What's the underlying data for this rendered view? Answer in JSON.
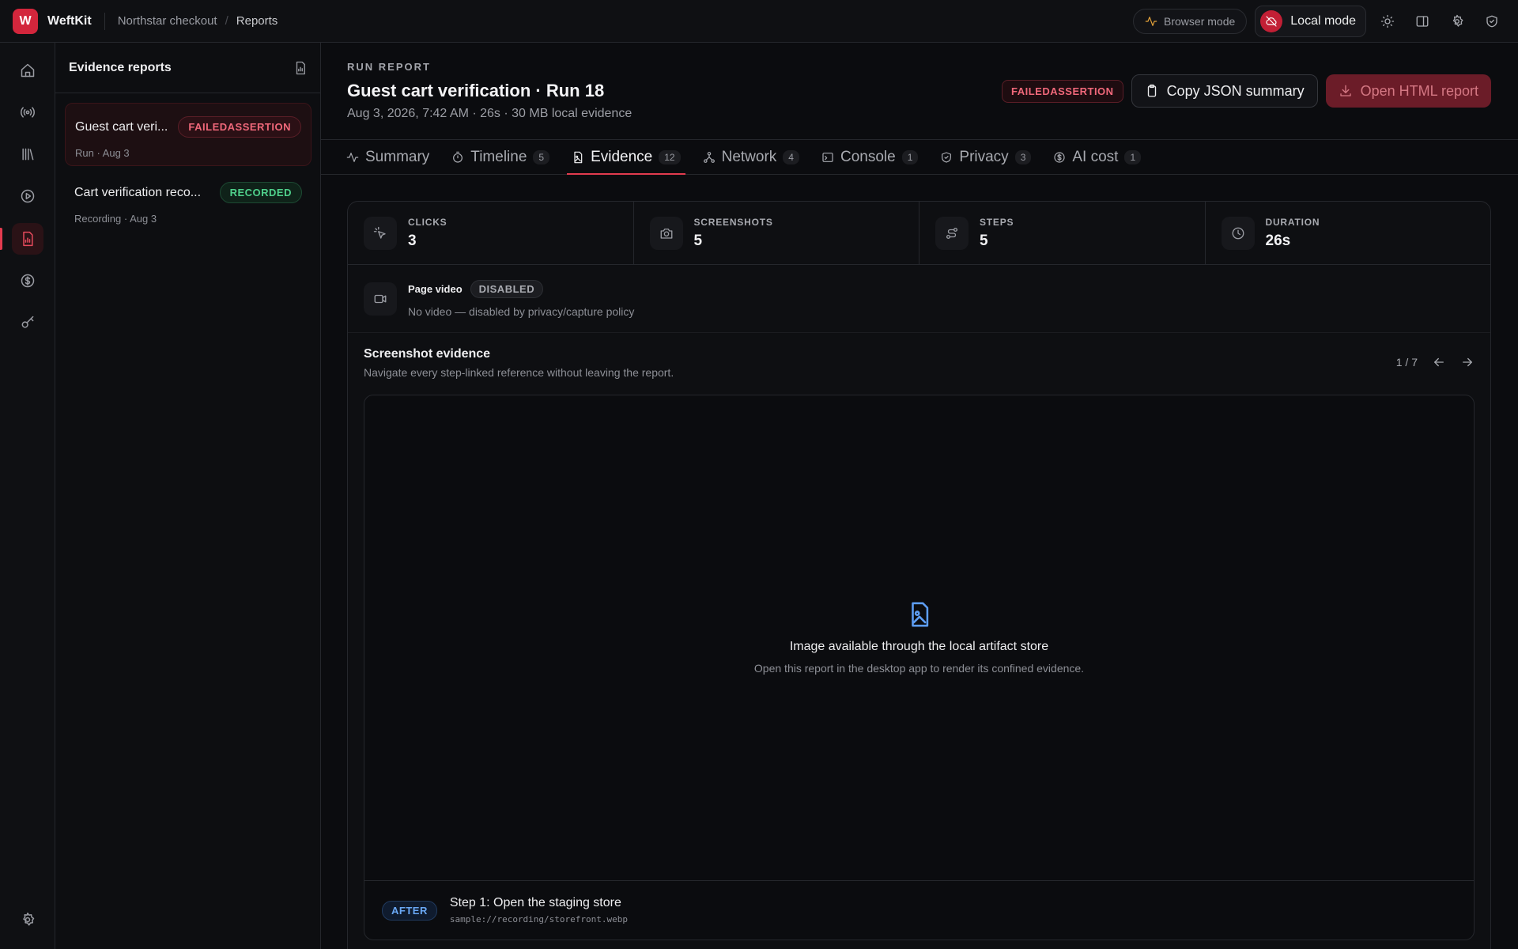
{
  "app": {
    "logo_letter": "W",
    "name": "WeftKit"
  },
  "breadcrumb": [
    "Northstar checkout",
    "Reports"
  ],
  "topbar": {
    "browser_mode": "Browser mode",
    "local_mode": "Local mode"
  },
  "reports_panel": {
    "title": "Evidence reports",
    "items": [
      {
        "name": "Guest cart veri...",
        "badge": "FAILEDASSERTION",
        "sub": "Run · Aug 3"
      },
      {
        "name": "Cart verification reco...",
        "badge": "RECORDED",
        "sub": "Recording · Aug 3"
      }
    ]
  },
  "run": {
    "kicker": "RUN REPORT",
    "title": "Guest cart verification · Run 18",
    "meta": "Aug 3, 2026, 7:42 AM · 26s · 30 MB local evidence",
    "status": "FAILEDASSERTION",
    "copy_button": "Copy JSON summary",
    "open_button": "Open HTML report"
  },
  "tabs": [
    {
      "label": "Summary",
      "count": ""
    },
    {
      "label": "Timeline",
      "count": "5"
    },
    {
      "label": "Evidence",
      "count": "12"
    },
    {
      "label": "Network",
      "count": "4"
    },
    {
      "label": "Console",
      "count": "1"
    },
    {
      "label": "Privacy",
      "count": "3"
    },
    {
      "label": "AI cost",
      "count": "1"
    }
  ],
  "stats": [
    {
      "label": "CLICKS",
      "value": "3"
    },
    {
      "label": "SCREENSHOTS",
      "value": "5"
    },
    {
      "label": "STEPS",
      "value": "5"
    },
    {
      "label": "DURATION",
      "value": "26s"
    }
  ],
  "video": {
    "title": "Page video",
    "badge": "DISABLED",
    "sub": "No video — disabled by privacy/capture policy"
  },
  "screenshot": {
    "title": "Screenshot evidence",
    "sub": "Navigate every step-linked reference without leaving the report.",
    "pager": "1 / 7",
    "placeholder_title": "Image available through the local artifact store",
    "placeholder_sub": "Open this report in the desktop app to render its confined evidence.",
    "step_badge": "AFTER",
    "step_title": "Step 1: Open the staging store",
    "step_path": "sample://recording/storefront.webp"
  },
  "colors": {
    "accent": "#e23b4f",
    "success": "#4fd08b",
    "info": "#5d9df3"
  }
}
